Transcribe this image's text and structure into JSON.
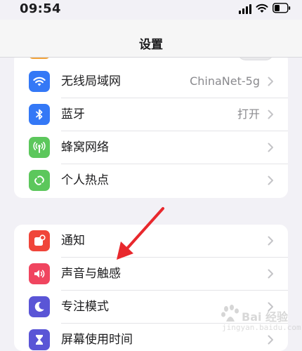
{
  "status_bar": {
    "time": "09:54",
    "icons": [
      "cellular-signal-icon",
      "wifi-icon",
      "battery-icon"
    ]
  },
  "nav": {
    "title": "设置"
  },
  "group_connectivity": {
    "items": [
      {
        "label": "无线局域网",
        "value": "ChinaNet-5g",
        "icon": "wifi-icon",
        "color": "#3478f6"
      },
      {
        "label": "蓝牙",
        "value": "打开",
        "icon": "bluetooth-icon",
        "color": "#3478f6"
      },
      {
        "label": "蜂窝网络",
        "value": "",
        "icon": "antenna-icon",
        "color": "#5cc75c"
      },
      {
        "label": "个人热点",
        "value": "",
        "icon": "hotspot-icon",
        "color": "#5cc75c"
      }
    ]
  },
  "group_notifications": {
    "items": [
      {
        "label": "通知",
        "icon": "notification-icon",
        "color": "#f0453a"
      },
      {
        "label": "声音与触感",
        "icon": "speaker-icon",
        "color": "#f0455f"
      },
      {
        "label": "专注模式",
        "icon": "moon-icon",
        "color": "#5a55d6"
      },
      {
        "label": "屏幕使用时间",
        "icon": "hourglass-icon",
        "color": "#5a55d6"
      }
    ]
  },
  "annotation": {
    "type": "red-arrow",
    "target": "声音与触感",
    "color": "#e8282d"
  },
  "watermark": {
    "text": "Bai 经验",
    "url": "jingyan.baidu.com"
  }
}
